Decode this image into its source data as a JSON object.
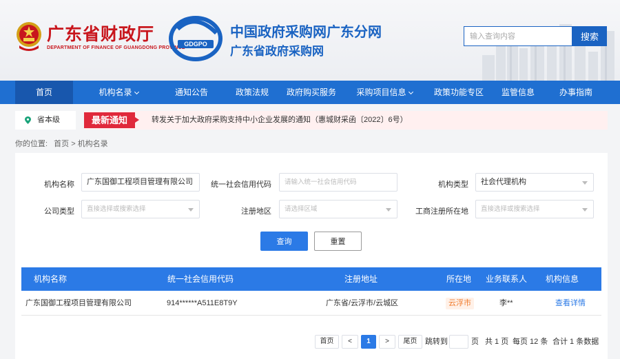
{
  "header": {
    "dept_cn": "广东省财政厅",
    "dept_en": "DEPARTMENT OF FINANCE OF GUANGDONG PROVINCE",
    "logo_text": "GDGPO",
    "site_title_1": "中国政府采购网广东分网",
    "site_title_2": "广东省政府采购网",
    "search_placeholder": "输入查询内容",
    "search_button": "搜索"
  },
  "nav": {
    "items": [
      {
        "label": "首页",
        "active": true
      },
      {
        "label": "机构名录",
        "dropdown": true
      },
      {
        "label": "通知公告"
      },
      {
        "label": "政策法规"
      },
      {
        "label": "政府购买服务"
      },
      {
        "label": "采购项目信息",
        "dropdown": true
      },
      {
        "label": "政策功能专区"
      },
      {
        "label": "监管信息"
      },
      {
        "label": "办事指南"
      }
    ]
  },
  "notice": {
    "level": "省本级",
    "badge": "最新通知",
    "text": "转发关于加大政府采购支持中小企业发展的通知（惠城财采函〔2022〕6号）"
  },
  "breadcrumb": {
    "prefix": "你的位置:",
    "home": "首页",
    "sep": ">",
    "current": "机构名录"
  },
  "form": {
    "org_name_label": "机构名称",
    "org_name_value": "广东国御工程项目管理有限公司",
    "credit_code_label": "统一社会信用代码",
    "credit_code_placeholder": "请输入统一社会信用代码",
    "org_type_label": "机构类型",
    "org_type_value": "社会代理机构",
    "company_type_label": "公司类型",
    "company_type_placeholder": "直接选择或搜索选择",
    "reg_region_label": "注册地区",
    "reg_region_placeholder": "请选择区域",
    "biz_reg_label": "工商注册所在地",
    "biz_reg_placeholder": "直接选择或搜索选择",
    "query_button": "查询",
    "reset_button": "重置"
  },
  "table": {
    "headers": [
      "机构名称",
      "统一社会信用代码",
      "注册地址",
      "所在地",
      "业务联系人",
      "机构信息"
    ],
    "rows": [
      {
        "name": "广东国御工程项目管理有限公司",
        "code": "914******A511E8T9Y",
        "address": "广东省/云浮市/云城区",
        "city": "云浮市",
        "contact": "李**",
        "info": "查看详情"
      }
    ]
  },
  "pagination": {
    "first": "首页",
    "prev": "<",
    "current": "1",
    "next": ">",
    "last": "尾页",
    "jump_to": "跳转到",
    "page_unit": "页",
    "total_pages": "共 1 页",
    "per_page": "每页 12 条",
    "total_records": "合计 1 条数据"
  },
  "colors": {
    "brand_blue": "#1f6fd1",
    "accent_blue": "#2b7ae6",
    "brand_red": "#c8161d",
    "notice_red": "#e0293b",
    "city_tag_orange": "#f07a2b"
  }
}
